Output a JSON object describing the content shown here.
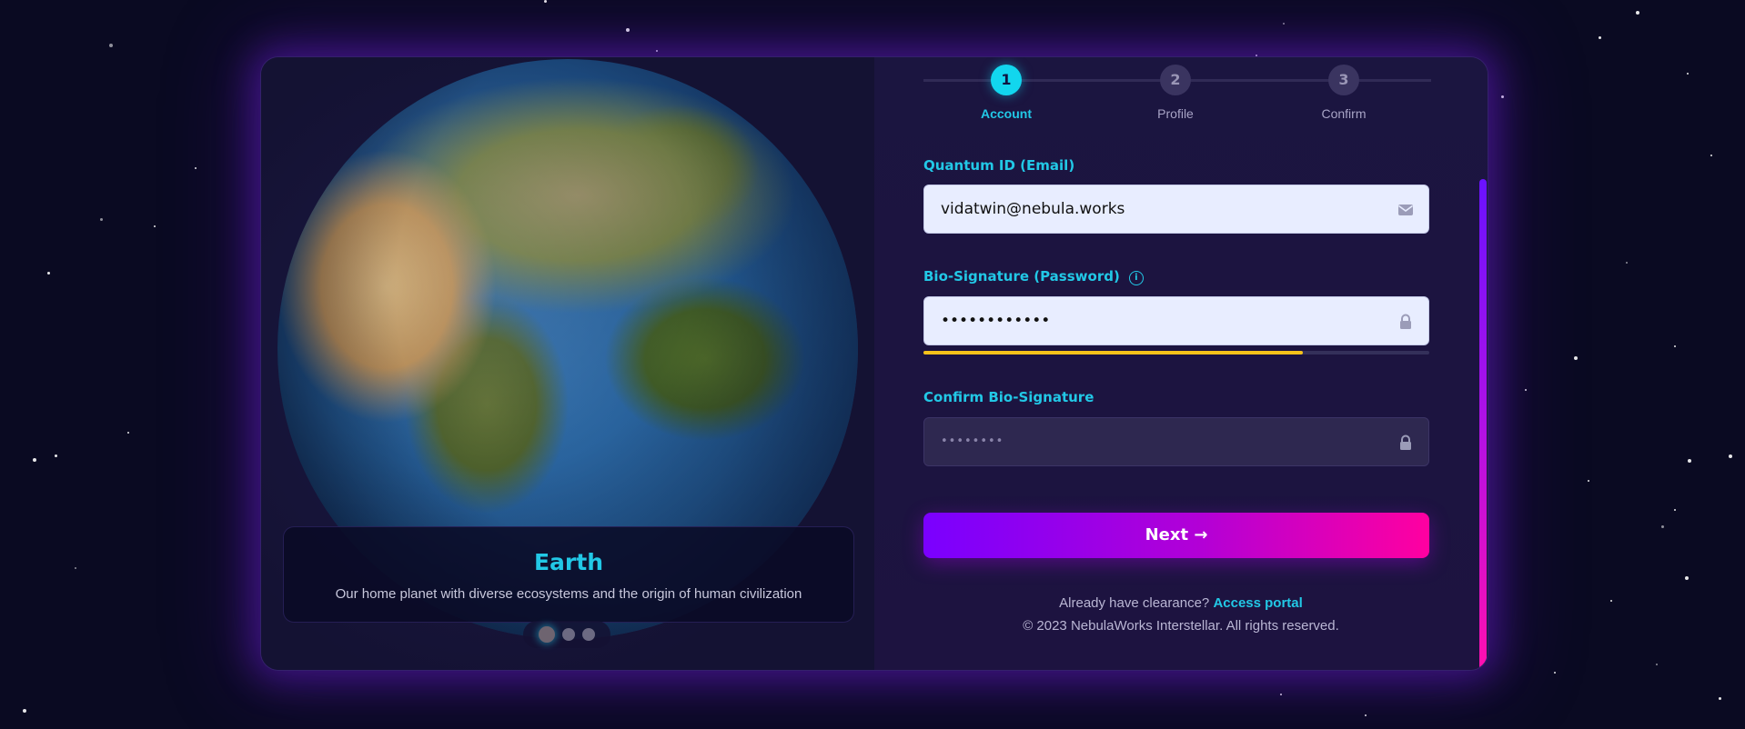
{
  "slide": {
    "title": "Earth",
    "description": "Our home planet with diverse ecosystems and the origin of human civilization",
    "dots": [
      {
        "active": true
      },
      {
        "active": false
      },
      {
        "active": false
      }
    ]
  },
  "steps": [
    {
      "number": "1",
      "label": "Account",
      "active": true
    },
    {
      "number": "2",
      "label": "Profile",
      "active": false
    },
    {
      "number": "3",
      "label": "Confirm",
      "active": false
    }
  ],
  "form": {
    "email": {
      "label": "Quantum ID (Email)",
      "value": "vidatwin@nebula.works",
      "icon": "envelope-icon"
    },
    "password": {
      "label": "Bio-Signature (Password)",
      "value": "••••••••••••",
      "icon": "lock-icon",
      "info_icon": "info-icon",
      "strength": 0.75,
      "strength_color": "#f6c21a"
    },
    "confirm": {
      "label": "Confirm Bio-Signature",
      "placeholder": "••••••••",
      "icon": "lock-icon"
    },
    "next_label": "Next →"
  },
  "footer": {
    "already_text": "Already have clearance? ",
    "access_link": "Access portal",
    "copyright": "© 2023 NebulaWorks Interstellar. All rights reserved."
  },
  "colors": {
    "accent": "#22c8e6",
    "button_gradient_start": "#7a00ff",
    "button_gradient_end": "#ff00a0",
    "background": "#0a0a22"
  }
}
